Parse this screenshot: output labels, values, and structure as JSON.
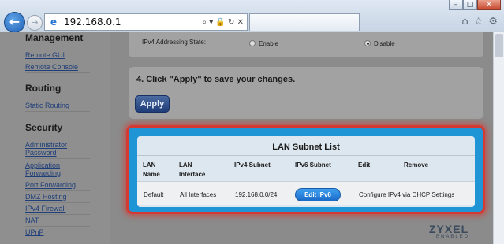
{
  "browser": {
    "address": "192.168.0.1",
    "address_icons": "⌕ ▾ 🔒 ↻ ✕",
    "window_buttons": {
      "minimize": "–",
      "maximize": "□",
      "close": "✕"
    }
  },
  "sidebar": {
    "sections": [
      {
        "title": "Management",
        "items": [
          "Remote GUI",
          "Remote Console"
        ]
      },
      {
        "title": "Routing",
        "items": [
          "Static Routing"
        ]
      },
      {
        "title": "Security",
        "items": [
          "Administrator Password",
          "Application Forwarding",
          "Port Forwarding",
          "DMZ Hosting",
          "IPv4 Firewall",
          "NAT",
          "UPnP"
        ]
      }
    ]
  },
  "ipv4": {
    "state_label": "IPv4 Addressing State:",
    "enable_label": "Enable",
    "disable_label": "Disable",
    "selected": "disable"
  },
  "step4": {
    "title": "4. Click \"Apply\" to save your changes.",
    "apply_label": "Apply"
  },
  "lan_list": {
    "title": "LAN Subnet List",
    "headers": [
      "LAN Name",
      "LAN Interface",
      "IPv4 Subnet",
      "IPv6 Subnet",
      "Edit",
      "Remove"
    ],
    "rows": [
      {
        "name": "Default",
        "interface": "All Interfaces",
        "ipv4_subnet": "192.168.0.0/24",
        "ipv6_action": "Edit IPv6",
        "edit": "Configure IPv4 via DHCP Settings"
      }
    ]
  },
  "brand": {
    "name": "ZYXEL",
    "sub": "ENABLED"
  },
  "colors": {
    "highlight": "#d43a32",
    "panel_blue": "#1f95d6",
    "button_blue": "#1a6bc9"
  }
}
